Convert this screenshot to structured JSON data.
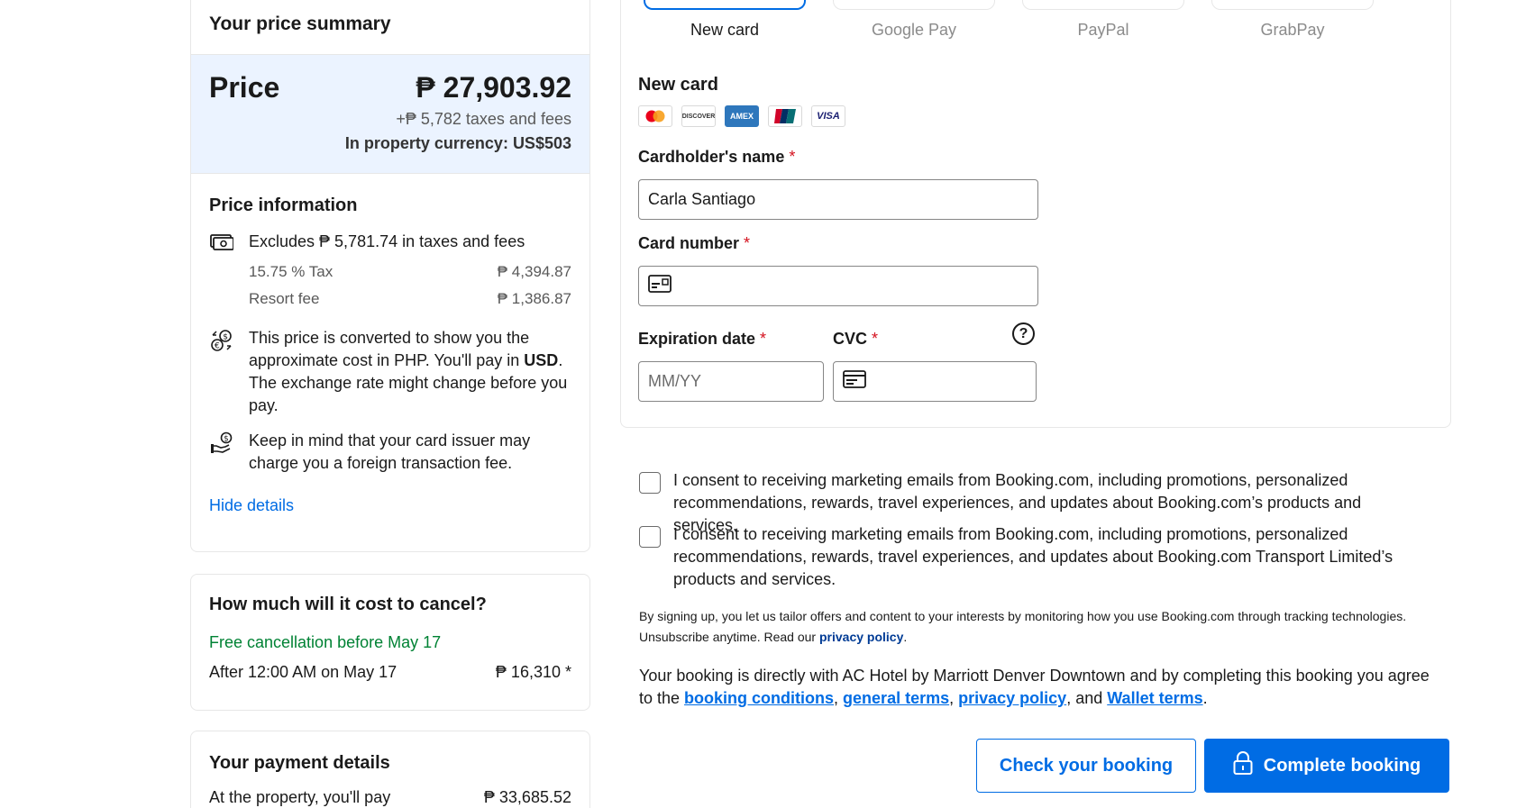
{
  "summary": {
    "heading": "Your price summary",
    "price_label": "Price",
    "price_value": "₱ 27,903.92",
    "taxes_line": "+₱ 5,782 taxes and fees",
    "currency_line": "In property currency: US$503"
  },
  "price_info": {
    "title": "Price information",
    "excludes": "Excludes ₱ 5,781.74 in taxes and fees",
    "taxes": [
      {
        "label": "15.75 % Tax",
        "value": "₱ 4,394.87"
      },
      {
        "label": "Resort fee",
        "value": "₱ 1,386.87"
      }
    ],
    "conversion_pre": "This price is converted to show you the approximate cost in PHP. You'll pay in ",
    "conversion_currency": "USD",
    "conversion_post": ". The exchange rate might change before you pay.",
    "card_fee_note": "Keep in mind that your card issuer may charge you a foreign transaction fee.",
    "hide_link": "Hide details"
  },
  "cancellation": {
    "title": "How much will it cost to cancel?",
    "free": "Free cancellation before May 17",
    "after_label": "After 12:00 AM on May 17",
    "after_value": "₱ 16,310 *"
  },
  "payment_details": {
    "title": "Your payment details",
    "row_label": "At the property, you'll pay",
    "row_value": "₱ 33,685.52"
  },
  "methods": [
    {
      "label": "New card"
    },
    {
      "label": "Google Pay"
    },
    {
      "label": "PayPal"
    },
    {
      "label": "GrabPay"
    }
  ],
  "new_card": {
    "title": "New card",
    "brands": [
      "mastercard-logo",
      "discover-logo",
      "amex-logo",
      "unionpay-logo",
      "visa-logo"
    ],
    "brand_text": {
      "discover": "DISCOVER",
      "amex": "AMEX",
      "visa": "VISA"
    },
    "holder_label": "Cardholder's name",
    "holder_value": "Carla Santiago",
    "number_label": "Card number",
    "number_value": "",
    "expiry_label": "Expiration date",
    "expiry_placeholder": "MM/YY",
    "cvc_label": "CVC",
    "cvc_value": "",
    "required_mark": "*"
  },
  "consents": [
    {
      "text": "I consent to receiving marketing emails from Booking.com, including promotions, personalized recommendations, rewards, travel experiences, and updates about Booking.com’s products and services."
    },
    {
      "text": "I consent to receiving marketing emails from Booking.com, including promotions, personalized recommendations, rewards, travel experiences, and updates about Booking.com Transport Limited’s products and services."
    }
  ],
  "signup_note": {
    "text": "By signing up, you let us tailor offers and content to your interests by monitoring how you use Booking.com through tracking technologies. Unsubscribe anytime. Read our ",
    "link": "privacy policy",
    "end": "."
  },
  "agreement": {
    "text": "Your booking is directly with AC Hotel by Marriott Denver Downtown and by completing this booking you agree to the ",
    "link1": "booking conditions",
    "sep1": ", ",
    "link2": "general terms",
    "sep2": ", ",
    "link3": "privacy policy",
    "sep3": ", and ",
    "link4": "Wallet terms",
    "end": "."
  },
  "buttons": {
    "check": "Check your booking",
    "complete": "Complete booking"
  },
  "colors": {
    "accent": "#006ce4",
    "price_box_bg": "#ebf3ff",
    "free_cancel": "#008234",
    "required": "#d4111e"
  }
}
